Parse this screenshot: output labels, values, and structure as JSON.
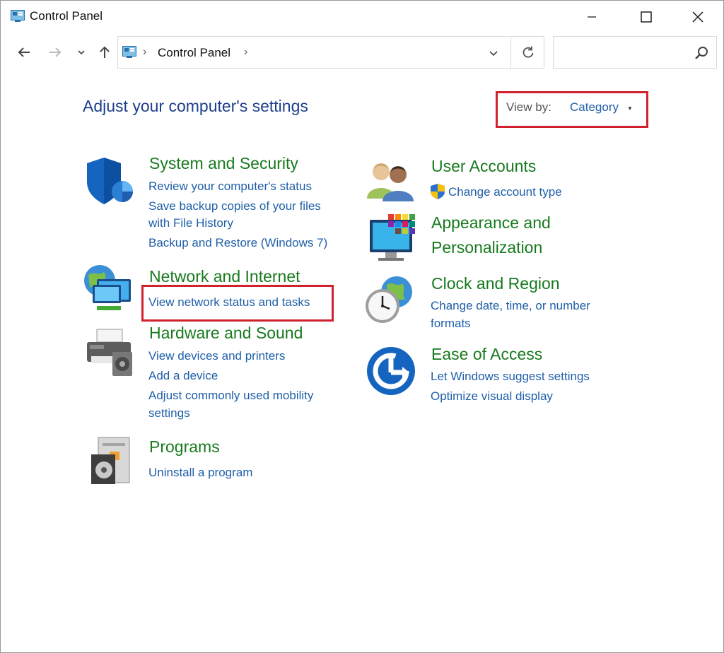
{
  "window": {
    "title": "Control Panel"
  },
  "navbar": {
    "breadcrumb": "Control Panel",
    "search_placeholder": ""
  },
  "content": {
    "heading": "Adjust your computer's settings",
    "view_by_label": "View by:",
    "view_by_value": "Category"
  },
  "categories": {
    "system_security": {
      "title": "System and Security",
      "links": [
        "Review your computer's status",
        "Save backup copies of your files",
        "with File History",
        "Backup and Restore (Windows 7)"
      ]
    },
    "network_internet": {
      "title": "Network and Internet",
      "links": [
        "View network status and tasks"
      ]
    },
    "hardware_sound": {
      "title": "Hardware and Sound",
      "links": [
        "View devices and printers",
        "Add a device",
        "Adjust commonly used mobility",
        "settings"
      ]
    },
    "programs": {
      "title": "Programs",
      "links": [
        "Uninstall a program"
      ]
    },
    "user_accounts": {
      "title": "User Accounts",
      "links": [
        "Change account type"
      ]
    },
    "appearance": {
      "title_line1": "Appearance and",
      "title_line2": "Personalization"
    },
    "clock_region": {
      "title": "Clock and Region",
      "links": [
        "Change date, time, or number",
        "formats"
      ]
    },
    "ease_access": {
      "title": "Ease of Access",
      "links": [
        "Let Windows suggest settings",
        "Optimize visual display"
      ]
    }
  },
  "colors": {
    "category_title": "#177a1e",
    "link": "#1f5fa8",
    "heading": "#1e3f8c",
    "highlight": "#d0212f"
  }
}
